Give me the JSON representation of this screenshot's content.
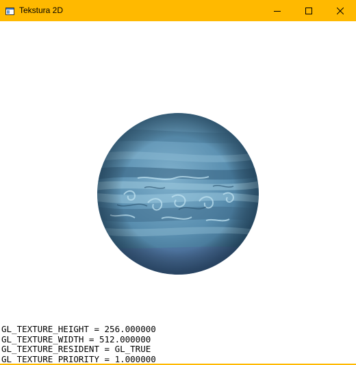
{
  "window": {
    "title": "Tekstura 2D",
    "accent_color": "#ffb900",
    "controls": {
      "minimize_icon": "minimize-icon",
      "maximize_icon": "maximize-icon",
      "close_icon": "close-icon"
    }
  },
  "scene": {
    "object": "textured-sphere",
    "texture_colors": [
      "#3e6e8e",
      "#6fa3c3",
      "#a9d3e6",
      "#2c5270"
    ]
  },
  "texture_info": [
    "GL_TEXTURE_HEIGHT = 256.000000",
    "GL_TEXTURE_WIDTH = 512.000000",
    "GL_TEXTURE_RESIDENT = GL_TRUE",
    "GL_TEXTURE_PRIORITY = 1.000000"
  ]
}
